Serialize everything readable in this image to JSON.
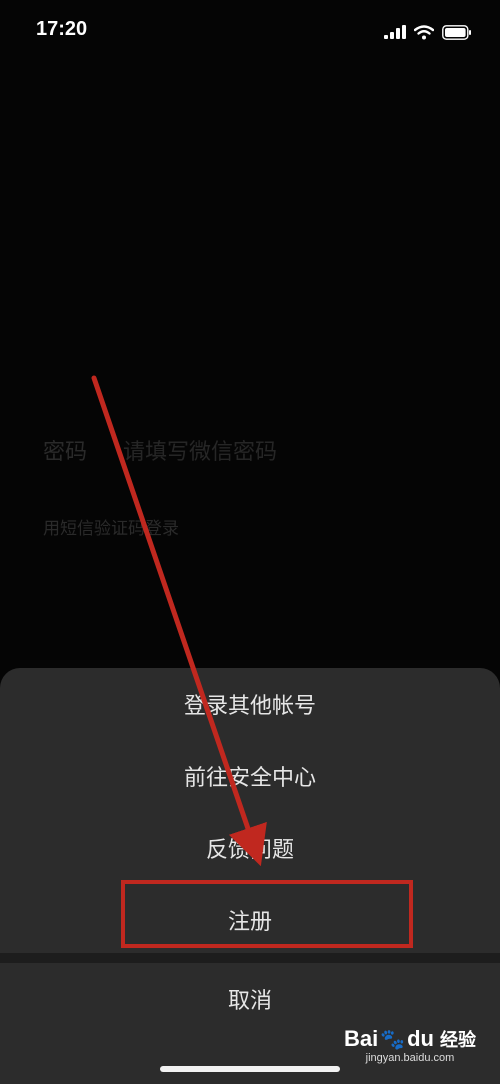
{
  "status": {
    "time": "17:20",
    "icons": [
      "signal-icon",
      "wifi-icon",
      "battery-icon"
    ]
  },
  "background": {
    "password_label": "密码",
    "password_placeholder": "请填写微信密码",
    "sms_login_link": "用短信验证码登录"
  },
  "sheet": {
    "items": [
      {
        "label": "登录其他帐号"
      },
      {
        "label": "前往安全中心"
      },
      {
        "label": "反馈问题"
      },
      {
        "label": "注册"
      }
    ],
    "cancel_label": "取消"
  },
  "watermark": {
    "brand_bai": "Bai",
    "brand_du": "du",
    "brand_jingyan": "经验",
    "url": "jingyan.baidu.com"
  },
  "colors": {
    "annotation": "#c0281f",
    "sheet_bg": "#2c2c2c"
  }
}
